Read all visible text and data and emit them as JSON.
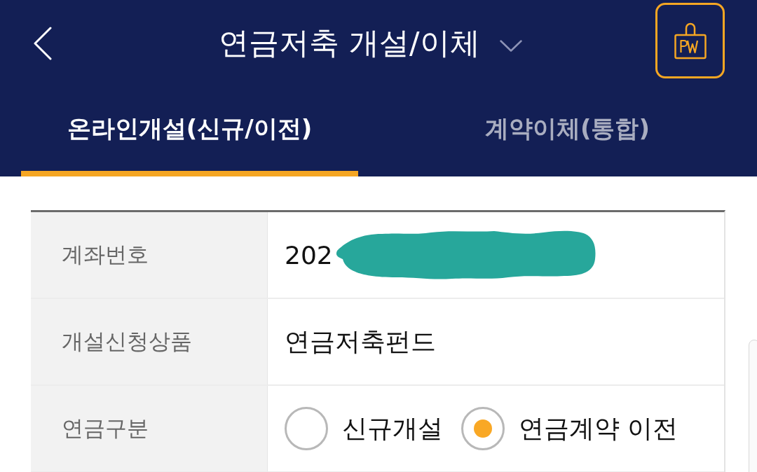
{
  "header": {
    "title": "연금저축 개설/이체"
  },
  "tabs": [
    {
      "label": "온라인개설(신규/이전)",
      "selected": true
    },
    {
      "label": "계약이체(통합)",
      "selected": false
    }
  ],
  "form": {
    "rows": [
      {
        "kind": "text",
        "label": "계좌번호",
        "value": "202",
        "redacted": true
      },
      {
        "kind": "text",
        "label": "개설신청상품",
        "value": "연금저축펀드",
        "redacted": false
      },
      {
        "kind": "radio",
        "label": "연금구분",
        "options": [
          {
            "label": "신규개설",
            "selected": false
          },
          {
            "label": "연금계약 이전",
            "selected": true
          }
        ]
      }
    ]
  }
}
